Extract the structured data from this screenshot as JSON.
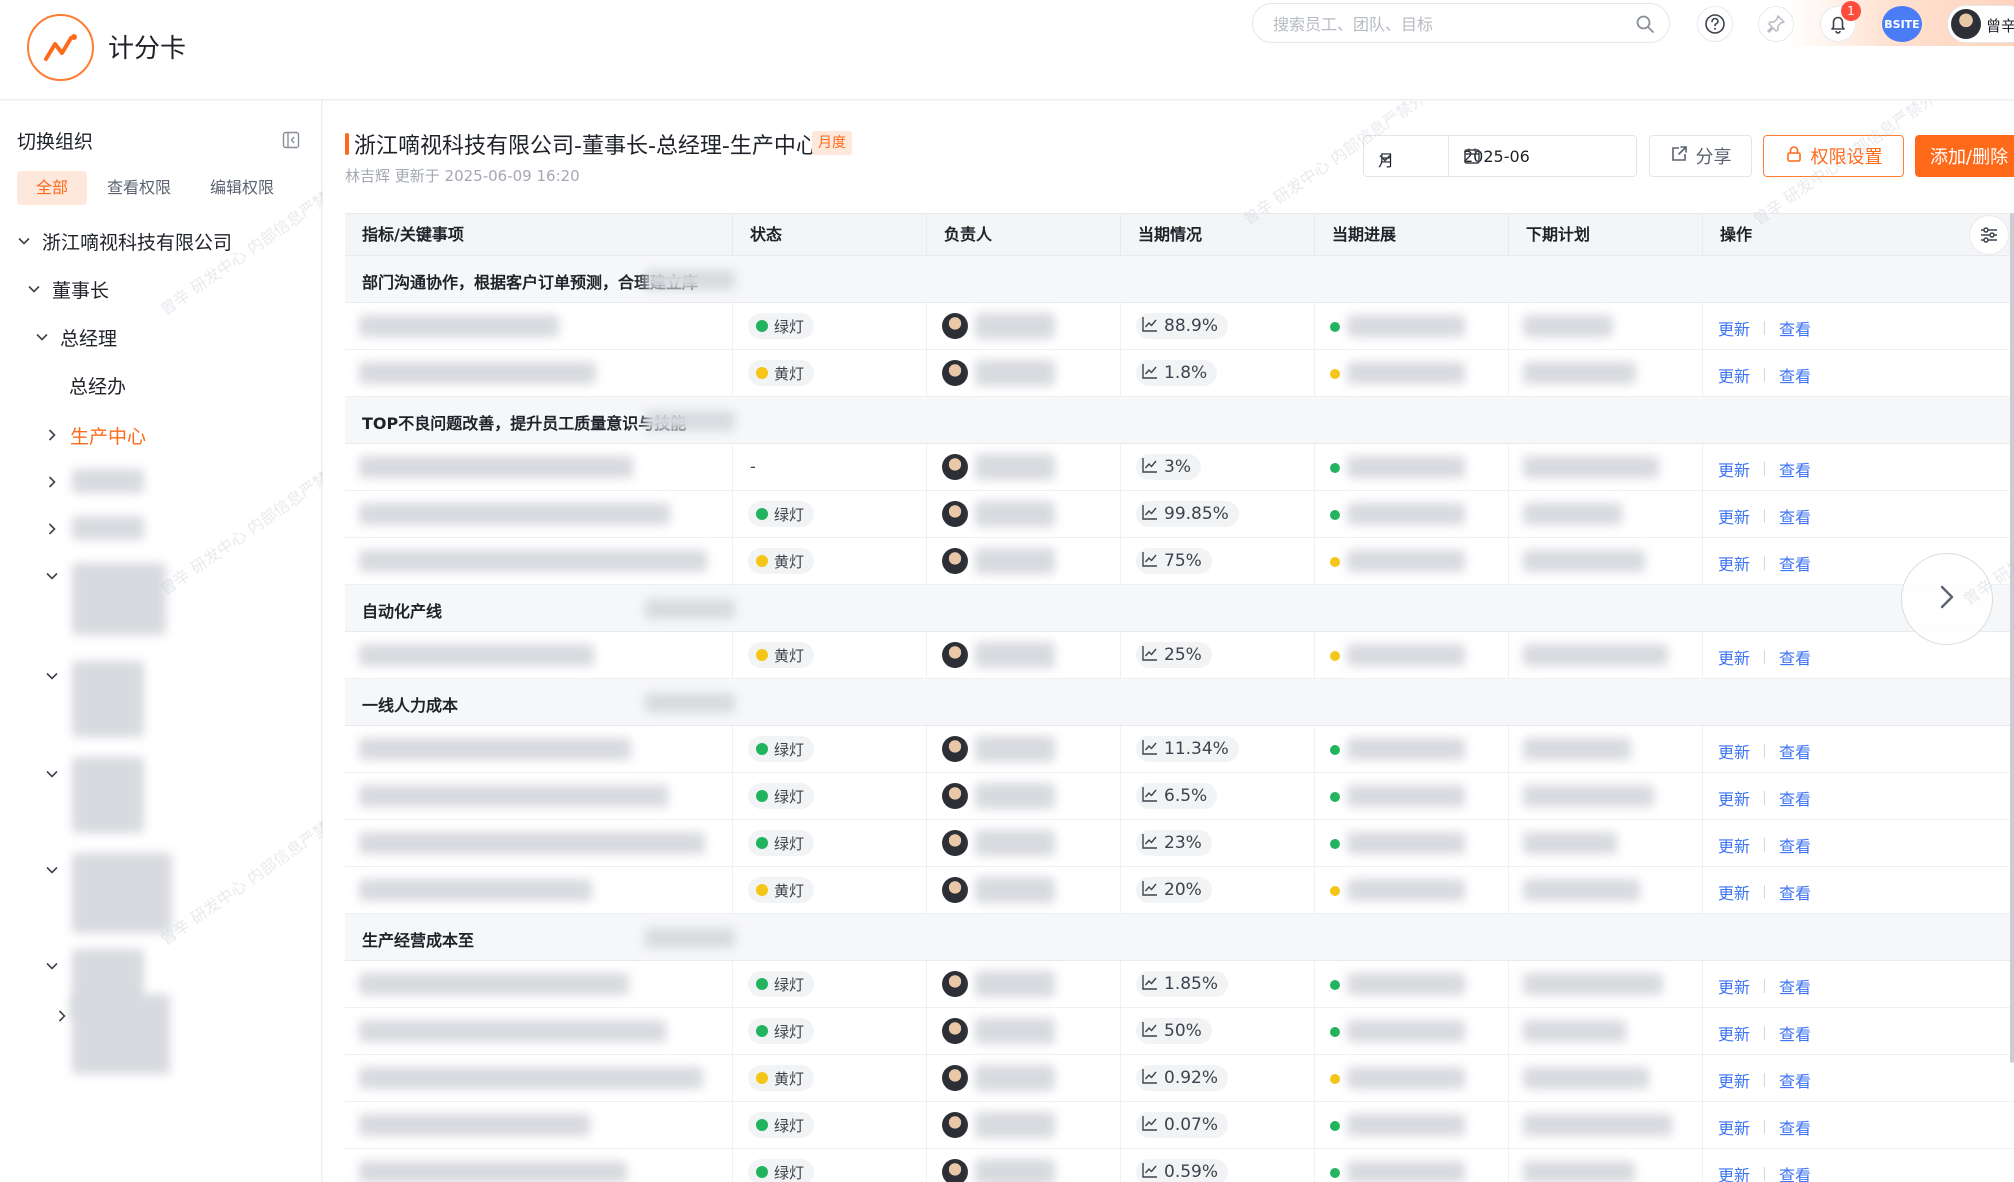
{
  "app": {
    "title": "计分卡"
  },
  "header": {
    "search_placeholder": "搜索员工、团队、目标",
    "notification_count": "1",
    "team_avatar_text": "BSITE",
    "user_name": "曾辛"
  },
  "sidebar": {
    "title": "切换组织",
    "tabs": [
      "全部",
      "查看权限",
      "编辑权限"
    ],
    "tree": [
      {
        "label": "浙江嘀视科技有限公司"
      },
      {
        "label": "董事长"
      },
      {
        "label": "总经理"
      },
      {
        "label": "总经办"
      },
      {
        "label": "生产中心"
      }
    ]
  },
  "main": {
    "title": "浙江嘀视科技有限公司-董事长-总经理-生产中心",
    "period_tag": "月度",
    "updated_text": "林吉辉 更新于 2025-06-09 16:20",
    "period_select": "月",
    "date_value": "2025-06",
    "share_label": "分享",
    "permission_label": "权限设置",
    "add_label": "添加/删除"
  },
  "table": {
    "columns": [
      "指标/关键事项",
      "状态",
      "负责人",
      "当期情况",
      "当期进展",
      "下期计划",
      "操作"
    ],
    "op_update": "更新",
    "op_view": "查看",
    "groups": [
      {
        "title": "部门沟通协作，根据客户订单预测，合理建立库"
      },
      {
        "title": "TOP不良问题改善，提升员工质量意识与技能"
      },
      {
        "title": "自动化产线"
      },
      {
        "title": "一线人力成本"
      },
      {
        "title": "生产经营成本至"
      }
    ],
    "rows": [
      {
        "status": "绿灯",
        "value": "88.9%",
        "progress": "green"
      },
      {
        "status": "黄灯",
        "value": "1.8%",
        "progress": "yellow"
      },
      {
        "status": "-",
        "value": "3%",
        "progress": "green"
      },
      {
        "status": "绿灯",
        "value": "99.85%",
        "progress": "green"
      },
      {
        "status": "黄灯",
        "value": "75%",
        "progress": "yellow"
      },
      {
        "status": "黄灯",
        "value": "25%",
        "progress": "yellow"
      },
      {
        "status": "绿灯",
        "value": "11.34%",
        "progress": "green"
      },
      {
        "status": "绿灯",
        "value": "6.5%",
        "progress": "green"
      },
      {
        "status": "绿灯",
        "value": "23%",
        "progress": "green"
      },
      {
        "status": "黄灯",
        "value": "20%",
        "progress": "yellow"
      },
      {
        "status": "绿灯",
        "value": "1.85%",
        "progress": "green"
      },
      {
        "status": "绿灯",
        "value": "50%",
        "progress": "green"
      },
      {
        "status": "黄灯",
        "value": "0.92%",
        "progress": "yellow"
      },
      {
        "status": "绿灯",
        "value": "0.07%",
        "progress": "green"
      },
      {
        "status": "绿灯",
        "value": "0.59%",
        "progress": "green"
      }
    ]
  },
  "colors": {
    "accent": "#ff6a1a",
    "green": "#22b35e",
    "yellow": "#f5c518",
    "link": "#3d73f5"
  },
  "icons": [
    "logo-icon",
    "search-icon",
    "help-icon",
    "pin-icon",
    "bell-icon",
    "collapse-icon",
    "chevron-down-icon",
    "chevron-right-icon",
    "calendar-icon",
    "share-icon",
    "lock-icon",
    "trend-icon",
    "settings-icon",
    "arrow-right-icon"
  ]
}
